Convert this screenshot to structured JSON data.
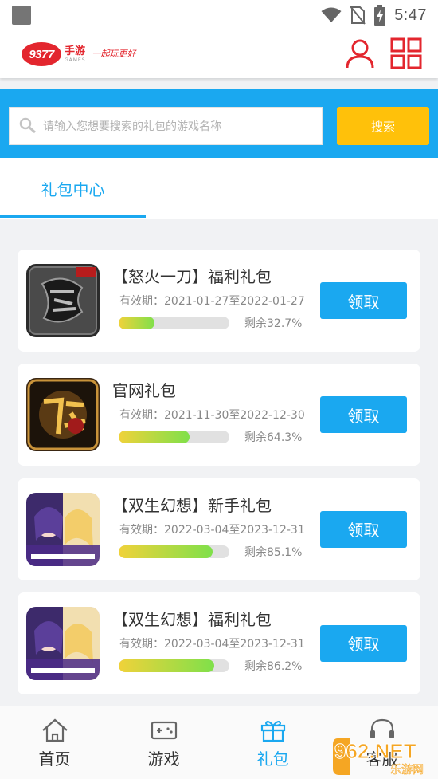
{
  "status_bar": {
    "time": "5:47"
  },
  "header": {
    "logo_number": "9377",
    "logo_cn": "手游",
    "logo_en": "GAMES",
    "logo_slogan": "一起玩更好"
  },
  "search": {
    "placeholder": "请输入您想要搜索的礼包的游戏名称",
    "button_label": "搜索"
  },
  "tabs": [
    {
      "label": "礼包中心",
      "active": true
    }
  ],
  "gifts": [
    {
      "title": "【怒火一刀】福利礼包",
      "validity": "有效期：2021-01-27至2022-01-27",
      "remaining": 32.7,
      "remaining_text": "剩余32.7%",
      "button": "领取",
      "game_icon": "dragon-game-icon"
    },
    {
      "title": "官网礼包",
      "validity": "有效期：2021-11-30至2022-12-30",
      "remaining": 64.3,
      "remaining_text": "剩余64.3%",
      "button": "领取",
      "game_icon": "legend-game-icon"
    },
    {
      "title": "【双生幻想】新手礼包",
      "validity": "有效期：2022-03-04至2023-12-31",
      "remaining": 85.1,
      "remaining_text": "剩余85.1%",
      "button": "领取",
      "game_icon": "twin-fantasy-game-icon"
    },
    {
      "title": "【双生幻想】福利礼包",
      "validity": "有效期：2022-03-04至2023-12-31",
      "remaining": 86.2,
      "remaining_text": "剩余86.2%",
      "button": "领取",
      "game_icon": "twin-fantasy-game-icon"
    }
  ],
  "bottom_nav": [
    {
      "label": "首页",
      "icon": "home-icon",
      "active": false
    },
    {
      "label": "游戏",
      "icon": "gamepad-icon",
      "active": false
    },
    {
      "label": "礼包",
      "icon": "gift-icon",
      "active": true
    },
    {
      "label": "客服",
      "icon": "headset-icon",
      "active": false
    }
  ],
  "watermark": {
    "text": "962.NET",
    "sub": "乐游网"
  },
  "colors": {
    "accent": "#1aa8f0",
    "search_button": "#ffc10a",
    "brand_red": "#e3262e"
  }
}
